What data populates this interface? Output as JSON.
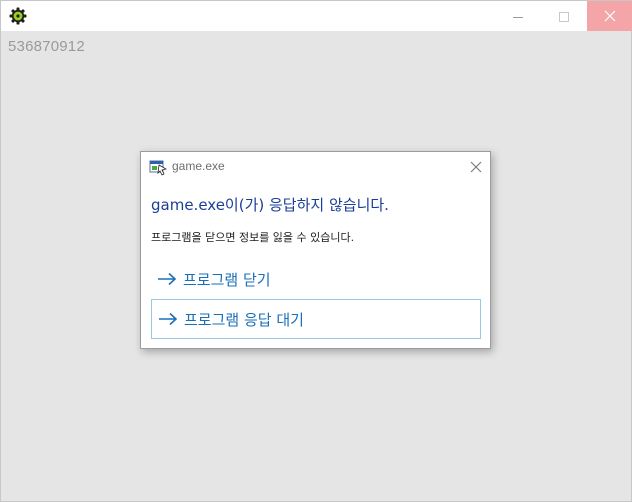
{
  "window": {
    "icon": "green-gear-icon",
    "counter": "536870912",
    "controls": {
      "minimize_icon": "minimize-icon",
      "maximize_icon": "maximize-icon",
      "close_icon": "close-icon",
      "close_hover_color": "#f3a5a8"
    }
  },
  "dialog": {
    "icon": "app-window-icon",
    "title": "game.exe",
    "heading": "game.exe이(가) 응답하지 않습니다.",
    "message": "프로그램을 닫으면 정보를 잃을 수 있습니다.",
    "options": [
      {
        "icon": "arrow-right-icon",
        "label": "프로그램 닫기"
      },
      {
        "icon": "arrow-right-icon",
        "label": "프로그램 응답 대기"
      }
    ],
    "accent_color": "#1a6fb8",
    "heading_color": "#1a3e97"
  }
}
